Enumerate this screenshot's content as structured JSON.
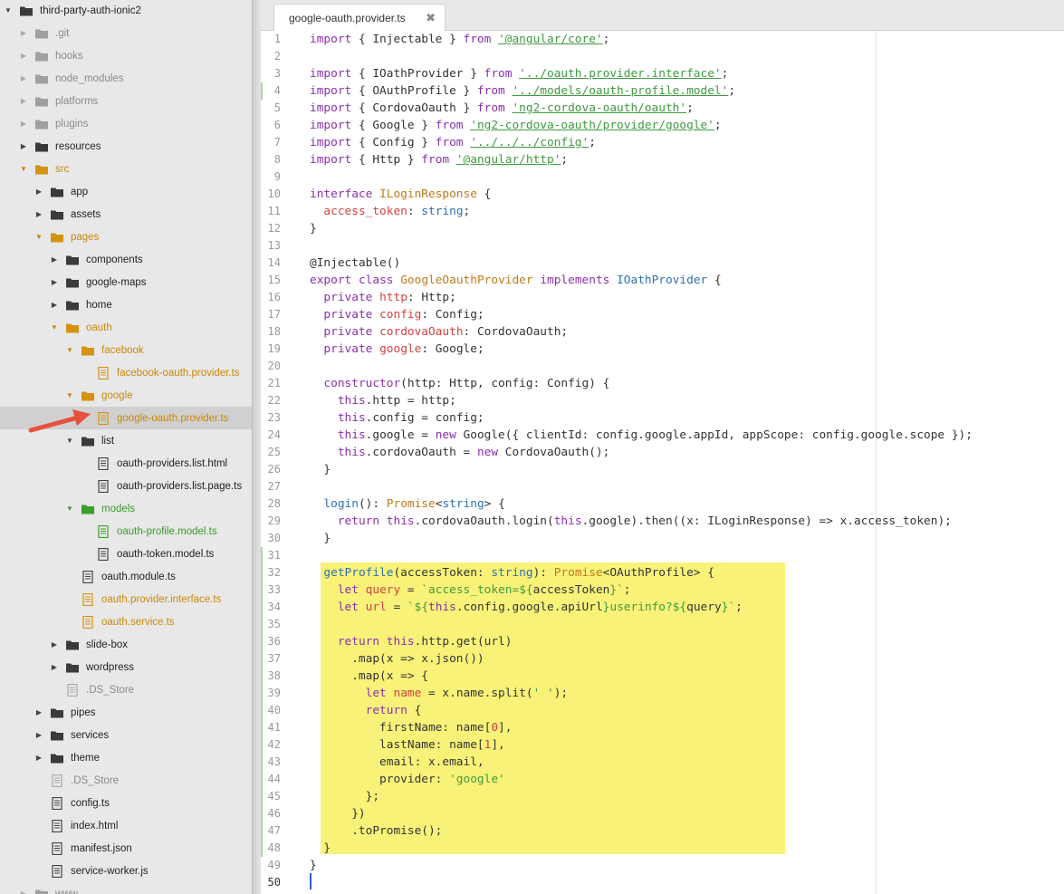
{
  "sidebar": {
    "items": [
      {
        "label": "third-party-auth-ionic2",
        "indent": 0,
        "arrow": "down",
        "icon": "folder",
        "style": "normal"
      },
      {
        "label": ".git",
        "indent": 1,
        "arrow": "right",
        "icon": "folder",
        "style": "dim"
      },
      {
        "label": "hooks",
        "indent": 1,
        "arrow": "right",
        "icon": "folder",
        "style": "dim"
      },
      {
        "label": "node_modules",
        "indent": 1,
        "arrow": "right",
        "icon": "folder",
        "style": "dim"
      },
      {
        "label": "platforms",
        "indent": 1,
        "arrow": "right",
        "icon": "folder",
        "style": "dim"
      },
      {
        "label": "plugins",
        "indent": 1,
        "arrow": "right",
        "icon": "folder",
        "style": "dim"
      },
      {
        "label": "resources",
        "indent": 1,
        "arrow": "right",
        "icon": "folder",
        "style": "normal"
      },
      {
        "label": "src",
        "indent": 1,
        "arrow": "down",
        "icon": "folder",
        "style": "orange"
      },
      {
        "label": "app",
        "indent": 2,
        "arrow": "right",
        "icon": "folder",
        "style": "normal"
      },
      {
        "label": "assets",
        "indent": 2,
        "arrow": "right",
        "icon": "folder",
        "style": "normal"
      },
      {
        "label": "pages",
        "indent": 2,
        "arrow": "down",
        "icon": "folder",
        "style": "orange"
      },
      {
        "label": "components",
        "indent": 3,
        "arrow": "right",
        "icon": "folder",
        "style": "normal"
      },
      {
        "label": "google-maps",
        "indent": 3,
        "arrow": "right",
        "icon": "folder",
        "style": "normal"
      },
      {
        "label": "home",
        "indent": 3,
        "arrow": "right",
        "icon": "folder",
        "style": "normal"
      },
      {
        "label": "oauth",
        "indent": 3,
        "arrow": "down",
        "icon": "folder",
        "style": "orange"
      },
      {
        "label": "facebook",
        "indent": 4,
        "arrow": "down",
        "icon": "folder",
        "style": "orange"
      },
      {
        "label": "facebook-oauth.provider.ts",
        "indent": 5,
        "arrow": "",
        "icon": "file",
        "style": "orange"
      },
      {
        "label": "google",
        "indent": 4,
        "arrow": "down",
        "icon": "folder",
        "style": "orange"
      },
      {
        "label": "google-oauth.provider.ts",
        "indent": 5,
        "arrow": "",
        "icon": "file",
        "style": "orange",
        "selected": true
      },
      {
        "label": "list",
        "indent": 4,
        "arrow": "down",
        "icon": "folder",
        "style": "normal"
      },
      {
        "label": "oauth-providers.list.html",
        "indent": 5,
        "arrow": "",
        "icon": "file",
        "style": "normal"
      },
      {
        "label": "oauth-providers.list.page.ts",
        "indent": 5,
        "arrow": "",
        "icon": "file",
        "style": "normal"
      },
      {
        "label": "models",
        "indent": 4,
        "arrow": "down",
        "icon": "folder",
        "style": "green"
      },
      {
        "label": "oauth-profile.model.ts",
        "indent": 5,
        "arrow": "",
        "icon": "file",
        "style": "green"
      },
      {
        "label": "oauth-token.model.ts",
        "indent": 5,
        "arrow": "",
        "icon": "file",
        "style": "normal"
      },
      {
        "label": "oauth.module.ts",
        "indent": 4,
        "arrow": "",
        "icon": "file",
        "style": "normal"
      },
      {
        "label": "oauth.provider.interface.ts",
        "indent": 4,
        "arrow": "",
        "icon": "file",
        "style": "orange"
      },
      {
        "label": "oauth.service.ts",
        "indent": 4,
        "arrow": "",
        "icon": "file",
        "style": "orange"
      },
      {
        "label": "slide-box",
        "indent": 3,
        "arrow": "right",
        "icon": "folder",
        "style": "normal"
      },
      {
        "label": "wordpress",
        "indent": 3,
        "arrow": "right",
        "icon": "folder",
        "style": "normal"
      },
      {
        "label": ".DS_Store",
        "indent": 3,
        "arrow": "",
        "icon": "file",
        "style": "dim"
      },
      {
        "label": "pipes",
        "indent": 2,
        "arrow": "right",
        "icon": "folder",
        "style": "normal"
      },
      {
        "label": "services",
        "indent": 2,
        "arrow": "right",
        "icon": "folder",
        "style": "normal"
      },
      {
        "label": "theme",
        "indent": 2,
        "arrow": "right",
        "icon": "folder",
        "style": "normal"
      },
      {
        "label": ".DS_Store",
        "indent": 2,
        "arrow": "",
        "icon": "file",
        "style": "dim"
      },
      {
        "label": "config.ts",
        "indent": 2,
        "arrow": "",
        "icon": "file",
        "style": "normal"
      },
      {
        "label": "index.html",
        "indent": 2,
        "arrow": "",
        "icon": "file",
        "style": "normal"
      },
      {
        "label": "manifest.json",
        "indent": 2,
        "arrow": "",
        "icon": "file",
        "style": "normal"
      },
      {
        "label": "service-worker.js",
        "indent": 2,
        "arrow": "",
        "icon": "file",
        "style": "normal"
      },
      {
        "label": "www",
        "indent": 1,
        "arrow": "right",
        "icon": "folder",
        "style": "dim"
      }
    ]
  },
  "editor": {
    "tab_label": "google-oauth.provider.ts",
    "tab_close": "✖",
    "active_line": "50",
    "lines": [
      {
        "n": "1",
        "html": "<span class=\"kw\">import</span> { Injectable } <span class=\"kw\">from</span> <span class=\"str\">'@angular/core'</span>;"
      },
      {
        "n": "2",
        "html": ""
      },
      {
        "n": "3",
        "html": "<span class=\"kw\">import</span> { IOathProvider } <span class=\"kw\">from</span> <span class=\"str\">'../oauth.provider.interface'</span>;"
      },
      {
        "n": "4",
        "html": "<span class=\"kw\">import</span> { OAuthProfile } <span class=\"kw\">from</span> <span class=\"str\">'../models/oauth-profile.model'</span>;"
      },
      {
        "n": "5",
        "html": "<span class=\"kw\">import</span> { CordovaOauth } <span class=\"kw\">from</span> <span class=\"str\">'ng2-cordova-oauth/oauth'</span>;"
      },
      {
        "n": "6",
        "html": "<span class=\"kw\">import</span> { Google } <span class=\"kw\">from</span> <span class=\"str\">'ng2-cordova-oauth/provider/google'</span>;"
      },
      {
        "n": "7",
        "html": "<span class=\"kw\">import</span> { Config } <span class=\"kw\">from</span> <span class=\"str\">'../../../config'</span>;"
      },
      {
        "n": "8",
        "html": "<span class=\"kw\">import</span> { Http } <span class=\"kw\">from</span> <span class=\"str\">'@angular/http'</span>;"
      },
      {
        "n": "9",
        "html": ""
      },
      {
        "n": "10",
        "html": "<span class=\"kw\">interface</span> <span class=\"cls\">ILoginResponse</span> {"
      },
      {
        "n": "11",
        "html": "  <span class=\"prop\">access_token</span>: <span class=\"typ\">string</span>;"
      },
      {
        "n": "12",
        "html": "}"
      },
      {
        "n": "13",
        "html": ""
      },
      {
        "n": "14",
        "html": "@Injectable()"
      },
      {
        "n": "15",
        "html": "<span class=\"kw\">export</span> <span class=\"kw\">class</span> <span class=\"cls\">GoogleOauthProvider</span> <span class=\"kw\">implements</span> <span class=\"typ\">IOathProvider</span> {"
      },
      {
        "n": "16",
        "html": "  <span class=\"kw\">private</span> <span class=\"prop\">http</span>: Http;"
      },
      {
        "n": "17",
        "html": "  <span class=\"kw\">private</span> <span class=\"prop\">config</span>: Config;"
      },
      {
        "n": "18",
        "html": "  <span class=\"kw\">private</span> <span class=\"prop\">cordovaOauth</span>: CordovaOauth;"
      },
      {
        "n": "19",
        "html": "  <span class=\"kw\">private</span> <span class=\"prop\">google</span>: Google;"
      },
      {
        "n": "20",
        "html": ""
      },
      {
        "n": "21",
        "html": "  <span class=\"kw\">constructor</span>(http: Http, config: Config) {"
      },
      {
        "n": "22",
        "html": "    <span class=\"kw\">this</span>.http = http;"
      },
      {
        "n": "23",
        "html": "    <span class=\"kw\">this</span>.config = config;"
      },
      {
        "n": "24",
        "html": "    <span class=\"kw\">this</span>.google = <span class=\"kw\">new</span> Google({ clientId: config.google.appId, appScope: config.google.scope });"
      },
      {
        "n": "25",
        "html": "    <span class=\"kw\">this</span>.cordovaOauth = <span class=\"kw\">new</span> CordovaOauth();"
      },
      {
        "n": "26",
        "html": "  }"
      },
      {
        "n": "27",
        "html": ""
      },
      {
        "n": "28",
        "html": "  <span class=\"typ\">login</span>(): <span class=\"cls\">Promise</span>&lt;<span class=\"typ\">string</span>&gt; {"
      },
      {
        "n": "29",
        "html": "    <span class=\"kw\">return</span> <span class=\"kw\">this</span>.cordovaOauth.login(<span class=\"kw\">this</span>.google).then((x: ILoginResponse) =&gt; x.access_token);"
      },
      {
        "n": "30",
        "html": "  }"
      },
      {
        "n": "31",
        "html": ""
      },
      {
        "n": "32",
        "html": "  <span class=\"typ\">getProfile</span>(accessToken: <span class=\"typ\">string</span>): <span class=\"cls\">Promise</span>&lt;OAuthProfile&gt; {"
      },
      {
        "n": "33",
        "html": "    <span class=\"kw\">let</span> <span class=\"prop\">query</span> = <span class=\"tmpl\">`access_token=${</span>accessToken<span class=\"tmpl\">}`</span>;"
      },
      {
        "n": "34",
        "html": "    <span class=\"kw\">let</span> <span class=\"prop\">url</span> = <span class=\"tmpl\">`${</span><span class=\"kw\">this</span>.config.google.apiUrl<span class=\"tmpl\">}userinfo?${</span>query<span class=\"tmpl\">}`</span>;"
      },
      {
        "n": "35",
        "html": ""
      },
      {
        "n": "36",
        "html": "    <span class=\"kw\">return</span> <span class=\"kw\">this</span>.http.get(url)"
      },
      {
        "n": "37",
        "html": "      .map(x =&gt; x.json())"
      },
      {
        "n": "38",
        "html": "      .map(x =&gt; {"
      },
      {
        "n": "39",
        "html": "        <span class=\"kw\">let</span> <span class=\"prop\">name</span> = x.name.split(<span class=\"str2\">' '</span>);"
      },
      {
        "n": "40",
        "html": "        <span class=\"kw\">return</span> {"
      },
      {
        "n": "41",
        "html": "          firstName: name[<span class=\"num\">0</span>],"
      },
      {
        "n": "42",
        "html": "          lastName: name[<span class=\"num\">1</span>],"
      },
      {
        "n": "43",
        "html": "          email: x.email,"
      },
      {
        "n": "44",
        "html": "          provider: <span class=\"str2\">'google'</span>"
      },
      {
        "n": "45",
        "html": "        };"
      },
      {
        "n": "46",
        "html": "      })"
      },
      {
        "n": "47",
        "html": "      .toPromise();"
      },
      {
        "n": "48",
        "html": "  }"
      },
      {
        "n": "49",
        "html": "}"
      },
      {
        "n": "50",
        "html": ""
      }
    ]
  },
  "colors": {
    "highlight": "#f8f279",
    "orange": "#c8880a",
    "green": "#3a9a2a",
    "annotation_arrow": "#e8503c"
  }
}
